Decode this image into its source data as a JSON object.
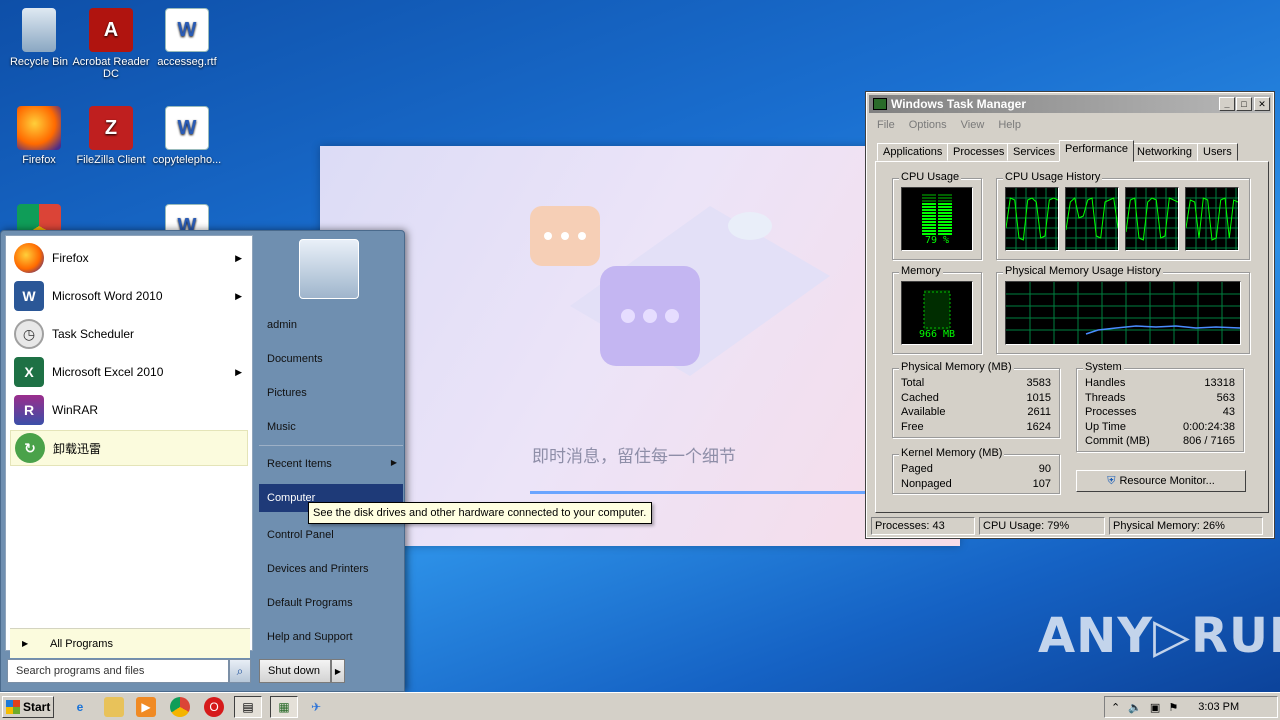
{
  "desktop": {
    "icons": [
      {
        "label": "Recycle Bin",
        "icon": "recycle-bin-icon"
      },
      {
        "label": "Acrobat Reader DC",
        "icon": "acrobat-icon"
      },
      {
        "label": "accesseg.rtf",
        "icon": "word-document-icon"
      },
      {
        "label": "Firefox",
        "icon": "firefox-icon"
      },
      {
        "label": "FileZilla Client",
        "icon": "filezilla-icon"
      },
      {
        "label": "copytelepho...",
        "icon": "word-document-icon"
      },
      {
        "label": "",
        "icon": "chrome-icon"
      },
      {
        "label": "",
        "icon": "word-document-icon"
      }
    ],
    "watermark": "ANY▷RUN"
  },
  "background_window": {
    "caption": "即时消息，留住每一个细节"
  },
  "start_menu": {
    "programs": [
      {
        "label": "Firefox",
        "has_submenu": true
      },
      {
        "label": "Microsoft Word 2010",
        "has_submenu": true
      },
      {
        "label": "Task Scheduler",
        "has_submenu": false
      },
      {
        "label": "Microsoft Excel 2010",
        "has_submenu": true
      },
      {
        "label": "WinRAR",
        "has_submenu": false
      },
      {
        "label": "卸载迅雷",
        "has_submenu": false
      }
    ],
    "all_programs": "All Programs",
    "search_placeholder": "Search programs and files",
    "right_items": [
      "admin",
      "Documents",
      "Pictures",
      "Music",
      "Recent Items",
      "Computer",
      "Control Panel",
      "Devices and Printers",
      "Default Programs",
      "Help and Support"
    ],
    "shutdown": "Shut down",
    "tooltip": "See the disk drives and other hardware connected to your computer."
  },
  "task_manager": {
    "title": "Windows Task Manager",
    "menu": [
      "File",
      "Options",
      "View",
      "Help"
    ],
    "tabs": [
      "Applications",
      "Processes",
      "Services",
      "Performance",
      "Networking",
      "Users"
    ],
    "active_tab": "Performance",
    "cpu_usage_label": "CPU Usage",
    "cpu_usage_value": "79 %",
    "cpu_usage_fraction": 0.79,
    "cpu_history_label": "CPU Usage History",
    "memory_label": "Memory",
    "memory_value": "966 MB",
    "mem_history_label": "Physical Memory Usage History",
    "physical_memory": {
      "label": "Physical Memory (MB)",
      "rows": [
        [
          "Total",
          "3583"
        ],
        [
          "Cached",
          "1015"
        ],
        [
          "Available",
          "2611"
        ],
        [
          "Free",
          "1624"
        ]
      ]
    },
    "system": {
      "label": "System",
      "rows": [
        [
          "Handles",
          "13318"
        ],
        [
          "Threads",
          "563"
        ],
        [
          "Processes",
          "43"
        ],
        [
          "Up Time",
          "0:00:24:38"
        ],
        [
          "Commit (MB)",
          "806 / 7165"
        ]
      ]
    },
    "kernel_memory": {
      "label": "Kernel Memory (MB)",
      "rows": [
        [
          "Paged",
          "90"
        ],
        [
          "Nonpaged",
          "107"
        ]
      ]
    },
    "resource_monitor": "Resource Monitor...",
    "status": {
      "processes": "Processes: 43",
      "cpu": "CPU Usage: 79%",
      "memory": "Physical Memory: 26%"
    }
  },
  "taskbar": {
    "start": "Start",
    "clock": "3:03 PM"
  }
}
